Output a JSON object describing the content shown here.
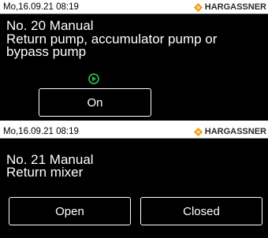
{
  "screens": [
    {
      "status": {
        "datetime": "Mo,16.09.21 08:19",
        "brand": "HARGASSNER"
      },
      "title_lines": [
        "No. 20 Manual",
        "Return pump, accumulator pump or",
        "bypass pump"
      ],
      "buttons": [
        "On"
      ]
    },
    {
      "status": {
        "datetime": "Mo,16.09.21 08:19",
        "brand": "HARGASSNER"
      },
      "title_lines": [
        "No. 21 Manual",
        "Return mixer"
      ],
      "buttons": [
        "Open",
        "Closed"
      ]
    }
  ],
  "colors": {
    "brand_diamond": "#f39200",
    "pump_icon": "#2fb34a"
  }
}
